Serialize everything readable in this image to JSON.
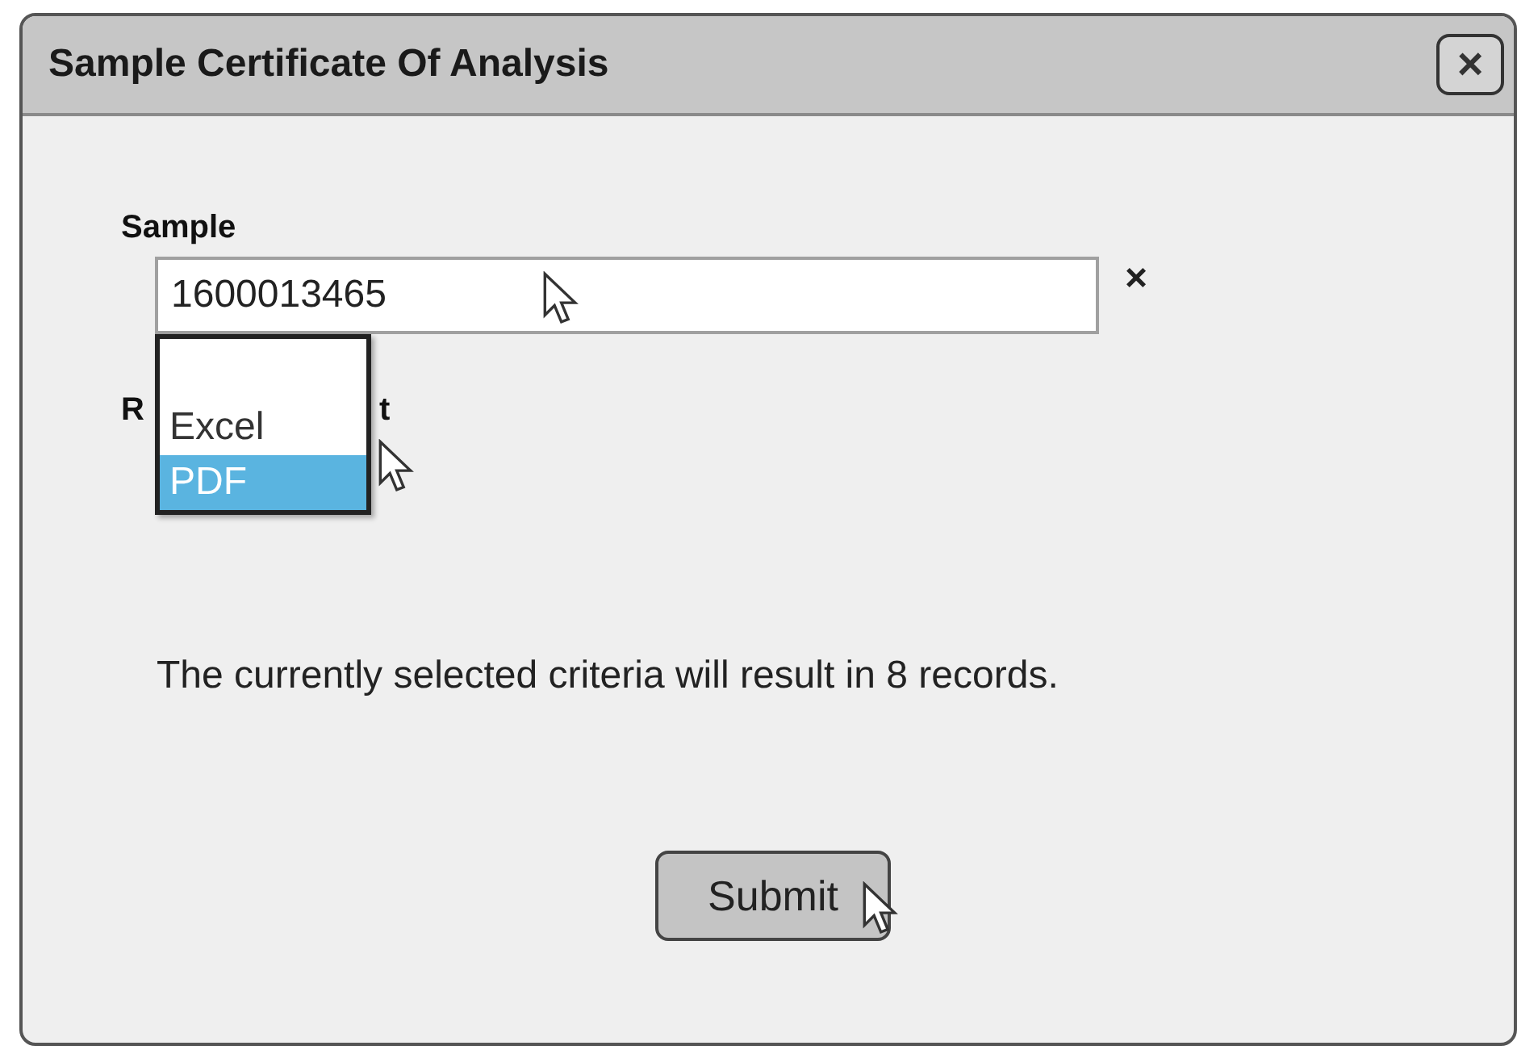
{
  "window": {
    "title": "Sample Certificate Of Analysis",
    "close_label": "×"
  },
  "sample": {
    "label": "Sample",
    "value": "1600013465",
    "clear_label": "×"
  },
  "report_format": {
    "label_visible_start": "R",
    "label_visible_end": "t",
    "options": [
      {
        "label": "Excel",
        "selected": false
      },
      {
        "label": "PDF",
        "selected": true
      }
    ]
  },
  "message": "The currently selected criteria will result in 8 records.",
  "buttons": [
    {
      "label": "Submit"
    }
  ]
}
